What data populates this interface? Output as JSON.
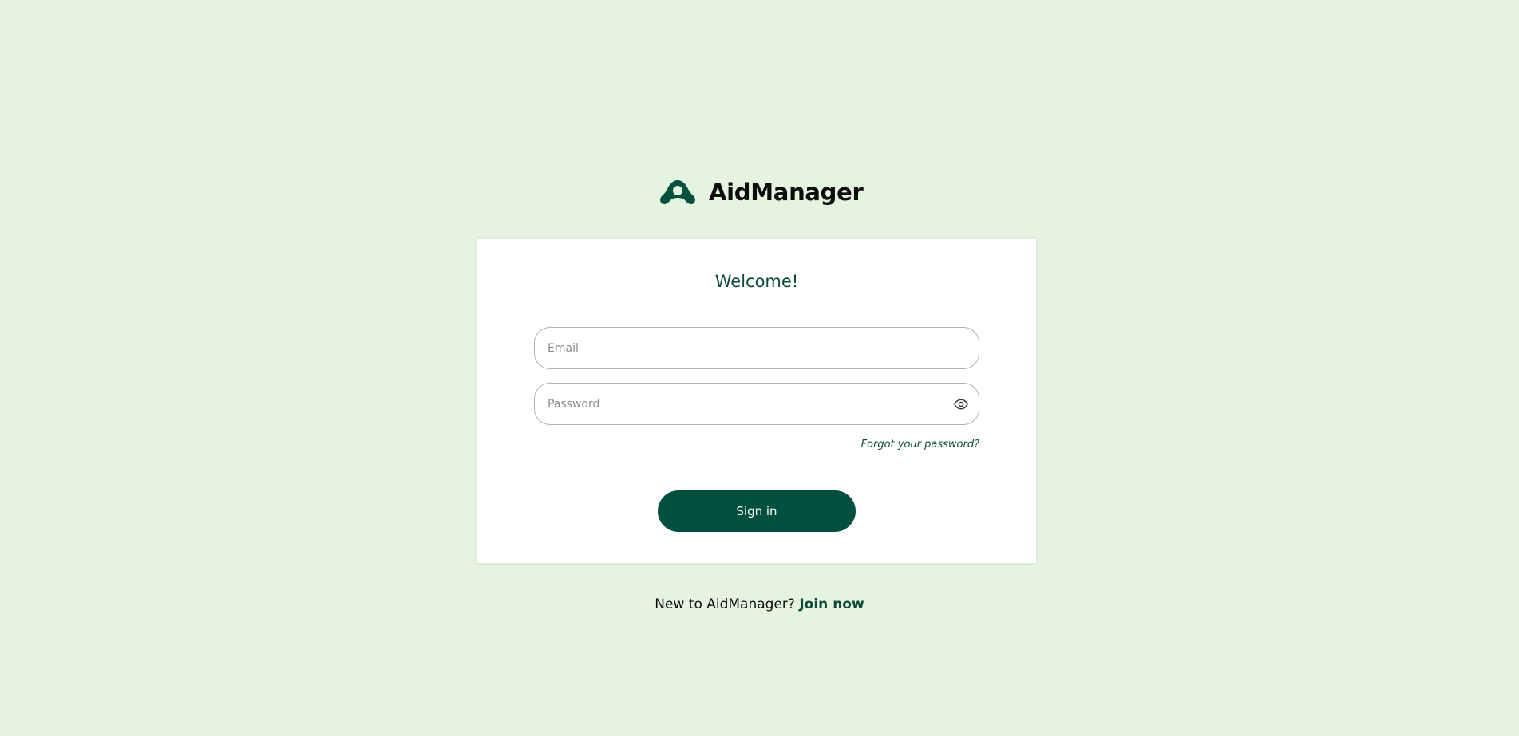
{
  "brand": {
    "name": "AidManager",
    "logo_icon": "aidmanager-logo-icon",
    "color": "#03503f"
  },
  "login": {
    "heading": "Welcome!",
    "email": {
      "placeholder": "Email",
      "value": ""
    },
    "password": {
      "placeholder": "Password",
      "value": "",
      "toggle_icon": "eye-icon"
    },
    "forgot_label": "Forgot your password?",
    "submit_label": "Sign in"
  },
  "signup": {
    "prompt": "New to AidManager?",
    "link_label": "Join now"
  },
  "colors": {
    "background": "#e5f4e1",
    "card": "#ffffff",
    "accent": "#03503f",
    "heading": "#0d4a3c"
  }
}
